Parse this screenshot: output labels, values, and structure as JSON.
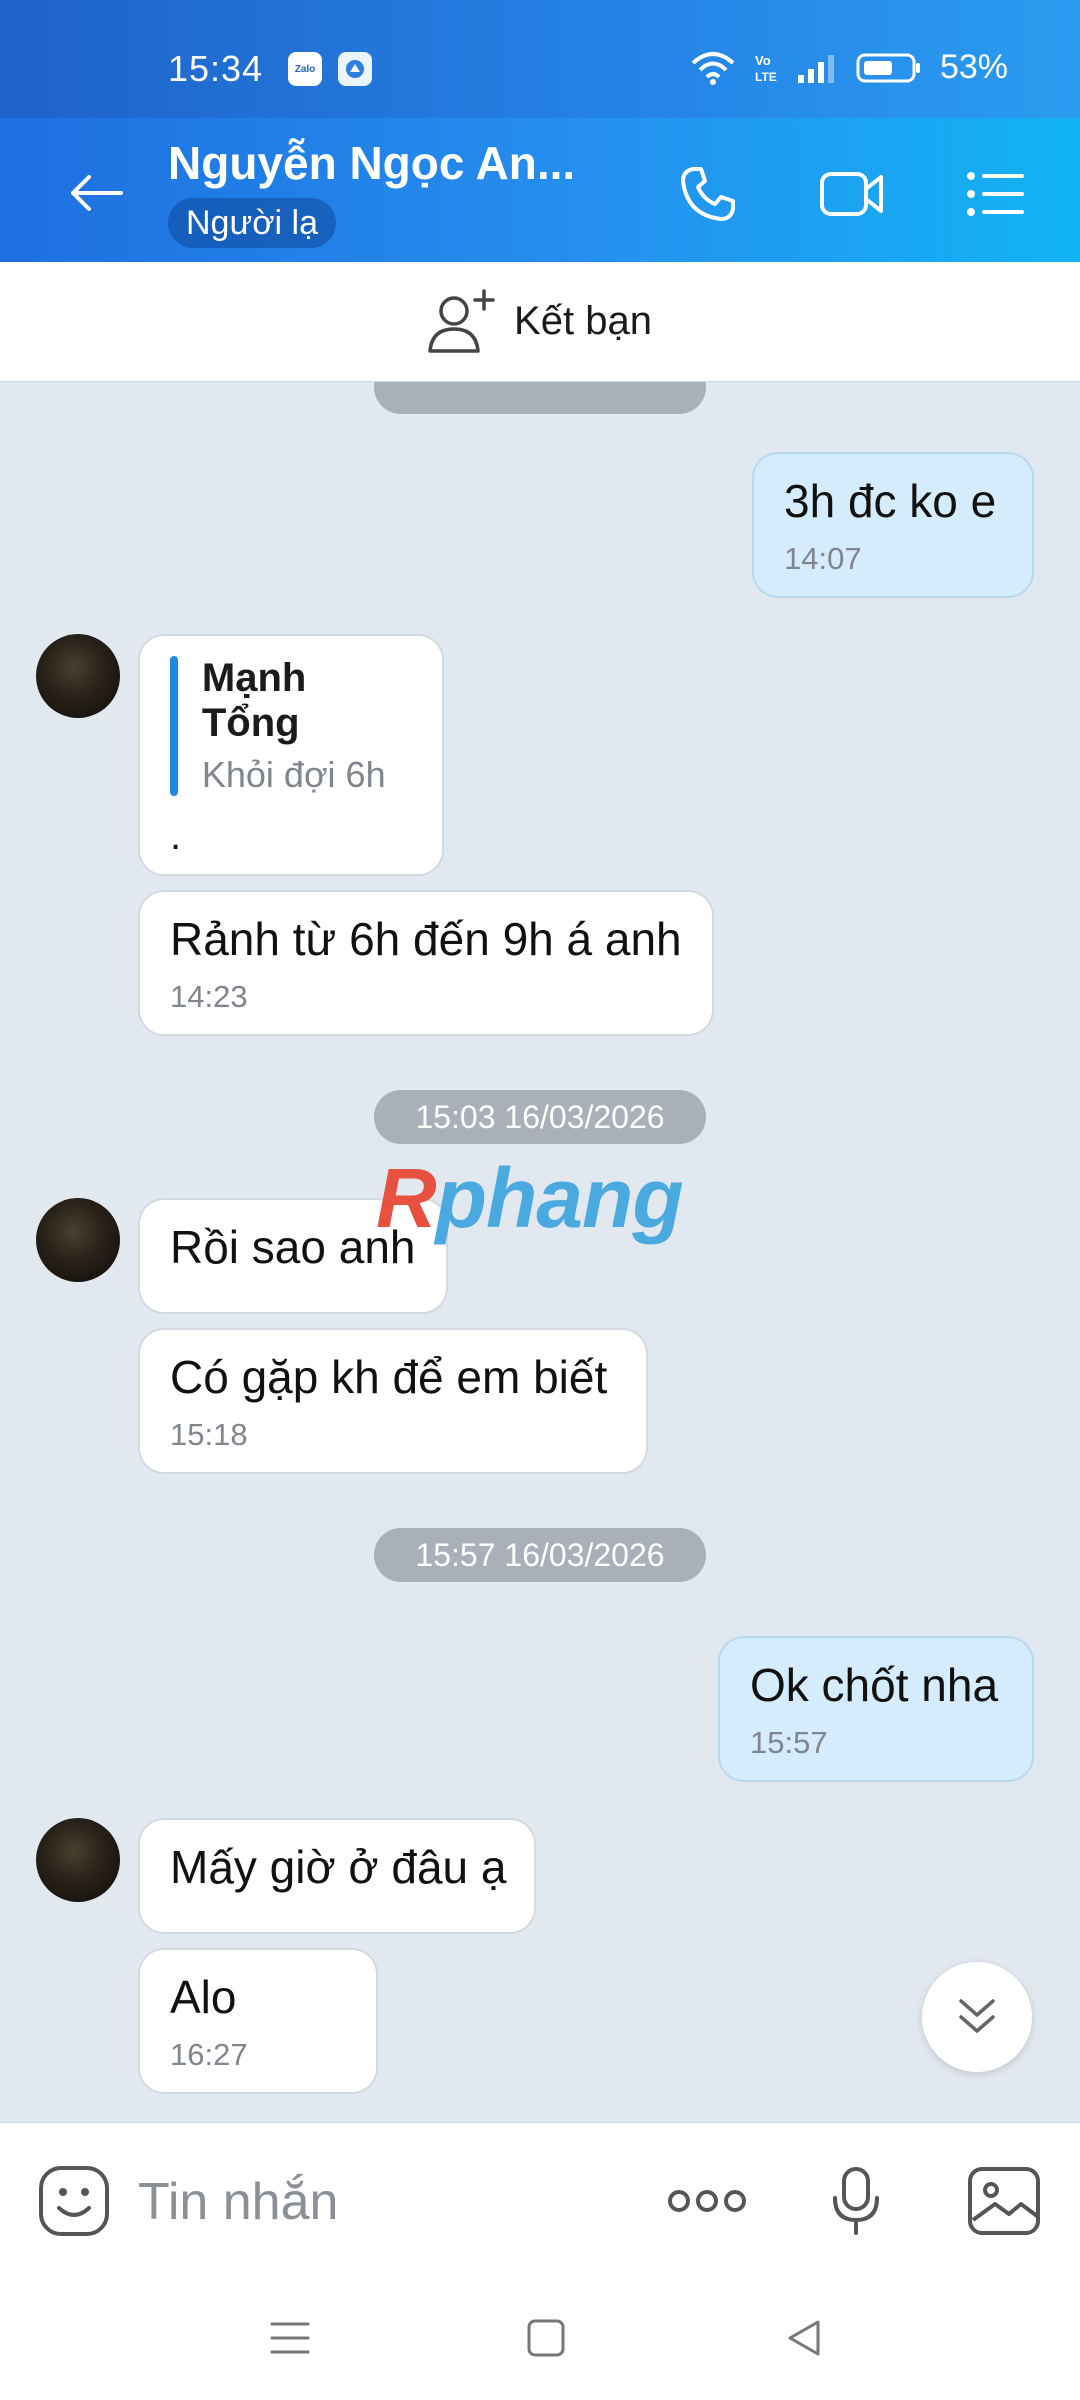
{
  "status_bar": {
    "time": "15:34",
    "battery": "53%",
    "app_icons": [
      "zalo-icon",
      "app-icon"
    ]
  },
  "header": {
    "title": "Nguyễn Ngọc An...",
    "badge": "Người lạ",
    "colors": {
      "gradient_start": "#1e6fe0",
      "gradient_end": "#12b4f6"
    }
  },
  "add_friend": {
    "label": "Kết bạn"
  },
  "chat": {
    "date_pills": [
      "15:03 16/03/2026",
      "15:57 16/03/2026"
    ],
    "messages": [
      {
        "side": "out",
        "text": "3h đc ko e",
        "time": "14:07"
      },
      {
        "side": "in",
        "quote_author": "Mạnh Tổng",
        "quote_text": "Khỏi đợi 6h",
        "text": "."
      },
      {
        "side": "in",
        "text": "Rảnh từ 6h đến 9h á anh",
        "time": "14:23"
      },
      {
        "side": "in",
        "text": "Rồi sao anh"
      },
      {
        "side": "in",
        "text": "Có gặp kh để em biết",
        "time": "15:18"
      },
      {
        "side": "out",
        "text": "Ok chốt nha",
        "time": "15:57"
      },
      {
        "side": "in",
        "text": "Mấy giờ ở đâu ạ"
      },
      {
        "side": "in",
        "text": "Alo",
        "time": "16:27"
      }
    ],
    "watermark": {
      "part1": "R",
      "part2": "phang"
    }
  },
  "input": {
    "placeholder": "Tin nhắn"
  },
  "colors": {
    "chat_bg": "#e2e8ef",
    "out_bubble": "#d4ecfc",
    "in_bubble": "#ffffff",
    "accent": "#1e88e5"
  }
}
